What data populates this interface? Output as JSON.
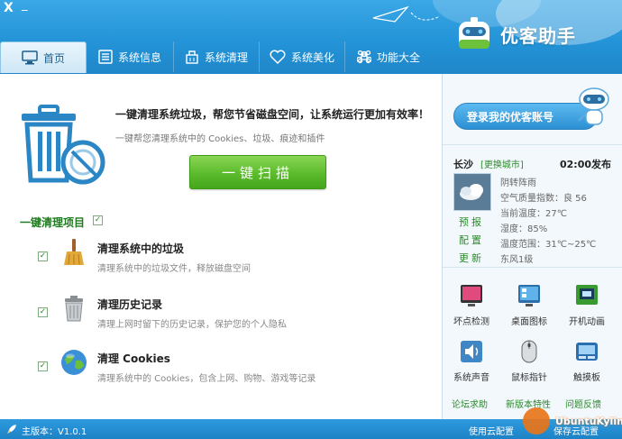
{
  "window": {
    "close_glyph": "X",
    "minimize_glyph": "_"
  },
  "brand": {
    "name": "优客助手"
  },
  "nav": {
    "tabs": [
      {
        "label": "首页",
        "icon": "monitor-icon",
        "active": true
      },
      {
        "label": "系统信息",
        "icon": "list-icon",
        "active": false
      },
      {
        "label": "系统清理",
        "icon": "broom-icon",
        "active": false
      },
      {
        "label": "系统美化",
        "icon": "heart-icon",
        "active": false
      },
      {
        "label": "功能大全",
        "icon": "command-icon",
        "active": false
      }
    ]
  },
  "main": {
    "headline": "一键清理系统垃圾，帮您节省磁盘空间，让系统运行更加有效率！",
    "subline": "一键帮您清理系统中的 Cookies、垃圾、痕迹和插件",
    "scan_button": "一键扫描",
    "items_title": "一键清理项目",
    "items_checked": true,
    "items": [
      {
        "title": "清理系统中的垃圾",
        "desc": "清理系统中的垃圾文件，释放磁盘空间",
        "checked": true,
        "icon": "broom-icon"
      },
      {
        "title": "清理历史记录",
        "desc": "清理上网时留下的历史记录，保护您的个人隐私",
        "checked": true,
        "icon": "trash-can-icon"
      },
      {
        "title": "清理 Cookies",
        "desc": "清理系统中的 Cookies，包含上网、购物、游戏等记录",
        "checked": true,
        "icon": "globe-icon"
      }
    ]
  },
  "right": {
    "login_button": "登录我的优客账号",
    "city": "长沙",
    "change_city": "[更换城市]",
    "publish_time": "02:00发布",
    "weather": [
      "阴转阵雨",
      "空气质量指数：良 56",
      "当前温度：27℃",
      "湿度：85%",
      "温度范围：31℃~25℃",
      "东风1级"
    ],
    "weather_links": [
      "预报",
      "配置",
      "更新"
    ],
    "tools": [
      {
        "label": "坏点检测",
        "icon": "monitor-test-icon"
      },
      {
        "label": "桌面图标",
        "icon": "desktop-icon"
      },
      {
        "label": "开机动画",
        "icon": "film-icon"
      },
      {
        "label": "系统声音",
        "icon": "speaker-icon"
      },
      {
        "label": "鼠标指针",
        "icon": "mouse-icon"
      },
      {
        "label": "触摸板",
        "icon": "touchpad-icon"
      }
    ],
    "bottom_links": [
      "论坛求助",
      "新版本特性",
      "问题反馈"
    ]
  },
  "status": {
    "version": "主版本：V1.0.1",
    "cloud_speed": "使用云配置",
    "cloud_config": "保存云配置",
    "watermark": "UbuntuKylin"
  },
  "colors": {
    "header": "#2494d8",
    "accent_green": "#5bbb2c",
    "link_green": "#2a8b2a"
  }
}
